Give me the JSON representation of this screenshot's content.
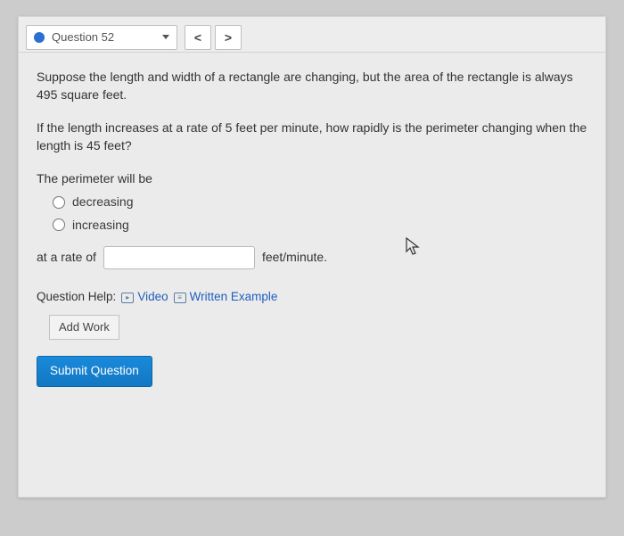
{
  "topbar": {
    "question_label": "Question 52",
    "prev": "<",
    "next": ">"
  },
  "content": {
    "para1": "Suppose the length and width of a rectangle are changing, but the area of the rectangle is always 495 square feet.",
    "para2": "If the length increases at a rate of 5 feet per minute, how rapidly is the perimeter changing when the length is 45 feet?",
    "lead": "The perimeter will be",
    "options": {
      "decreasing": "decreasing",
      "increasing": "increasing"
    },
    "rate_prefix": "at a rate of",
    "rate_value": "",
    "rate_unit": "feet/minute."
  },
  "help": {
    "label": "Question Help:",
    "video": "Video",
    "written": "Written Example",
    "addwork": "Add Work"
  },
  "submit": "Submit Question"
}
